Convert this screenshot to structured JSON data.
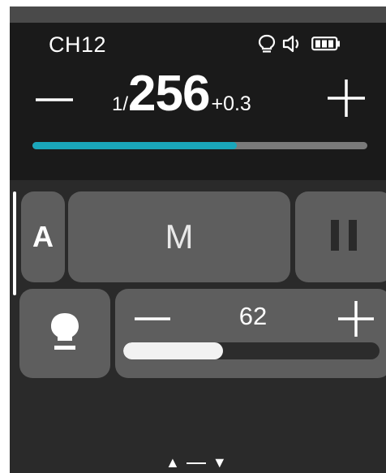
{
  "status": {
    "channel": "CH12",
    "icons": [
      "flash-bulb-icon",
      "speaker-icon",
      "battery-icon"
    ]
  },
  "shutter": {
    "numerator": "1/",
    "denominator": "256",
    "compensation": "+0.3",
    "progress": 0.61
  },
  "controls": {
    "auto_label": "A",
    "mode_label": "M",
    "pause_icon": "pause-icon",
    "lamp_icon": "lamp-icon",
    "power_value": "62",
    "power_level": 0.39
  },
  "nav": {
    "up_glyph": "▲",
    "down_glyph": "▼"
  },
  "colors": {
    "accent": "#1aa6ba",
    "button": "#5e5e5e",
    "background": "#1a1a1a"
  }
}
